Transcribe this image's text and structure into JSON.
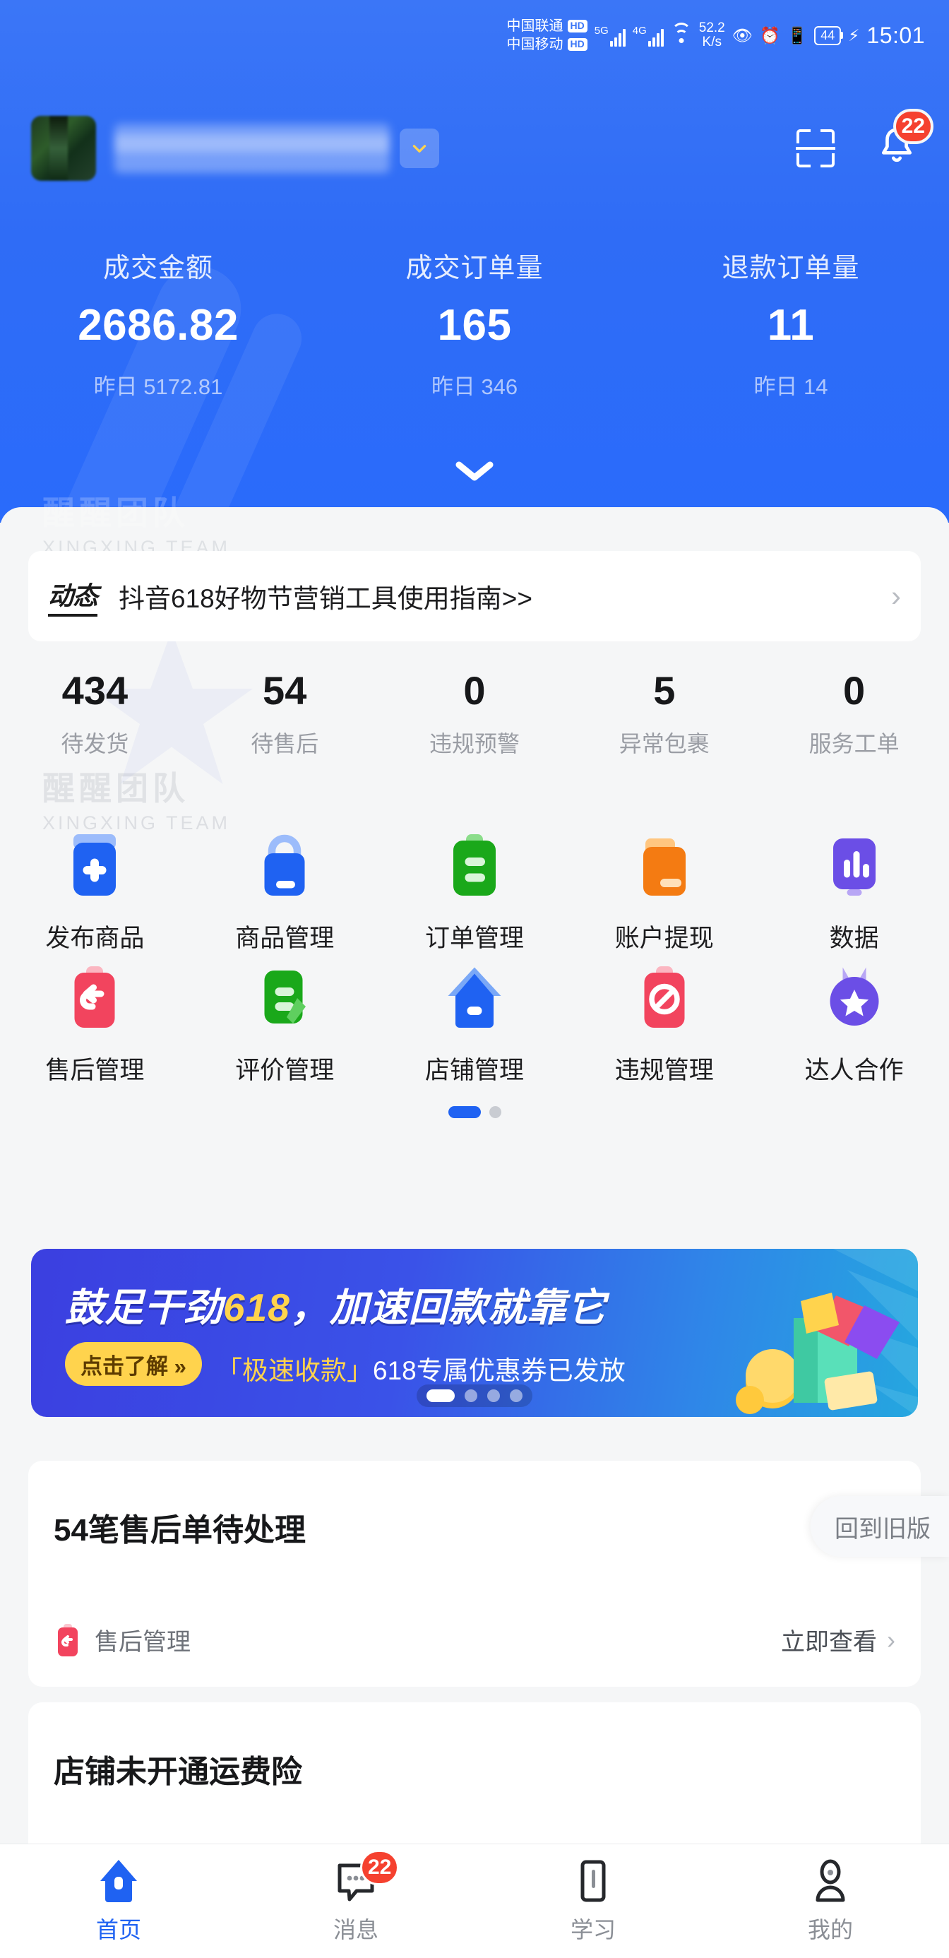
{
  "status_bar": {
    "carrier_1": "中国联通",
    "carrier_2": "中国移动",
    "hd_label": "HD",
    "net_1": "5G",
    "net_2": "4G",
    "speed": "52.2",
    "speed_unit": "K/s",
    "battery": "44",
    "time": "15:01"
  },
  "header": {
    "shop_name": "",
    "notification_badge": "22"
  },
  "hero_stats": [
    {
      "label": "成交金额",
      "value": "2686.82",
      "sub": "昨日 5172.81"
    },
    {
      "label": "成交订单量",
      "value": "165",
      "sub": "昨日 346"
    },
    {
      "label": "退款订单量",
      "value": "11",
      "sub": "昨日 14"
    }
  ],
  "watermark": {
    "cn": "醒醒团队",
    "en": "XINGXING TEAM"
  },
  "notice": {
    "tag": "动态",
    "text": "抖音618好物节营销工具使用指南>>"
  },
  "counters": [
    {
      "num": "434",
      "name": "待发货"
    },
    {
      "num": "54",
      "name": "待售后"
    },
    {
      "num": "0",
      "name": "违规预警"
    },
    {
      "num": "5",
      "name": "异常包裹"
    },
    {
      "num": "0",
      "name": "服务工单"
    }
  ],
  "grid": {
    "row1": [
      {
        "label": "发布商品",
        "icon": "plus-tag-icon",
        "color": "#1f62f2"
      },
      {
        "label": "商品管理",
        "icon": "shopping-bag-icon",
        "color": "#1f62f2"
      },
      {
        "label": "订单管理",
        "icon": "clipboard-icon",
        "color": "#1aa81a"
      },
      {
        "label": "账户提现",
        "icon": "folder-icon",
        "color": "#f47b12"
      },
      {
        "label": "数据",
        "icon": "bar-chart-icon",
        "color": "#6b4ee6"
      }
    ],
    "row2": [
      {
        "label": "售后管理",
        "icon": "return-tag-icon",
        "color": "#f2445e"
      },
      {
        "label": "评价管理",
        "icon": "review-pen-icon",
        "color": "#1aa81a"
      },
      {
        "label": "店铺管理",
        "icon": "home-icon",
        "color": "#1f62f2"
      },
      {
        "label": "违规管理",
        "icon": "ban-tag-icon",
        "color": "#f2445e"
      },
      {
        "label": "达人合作",
        "icon": "star-medal-icon",
        "color": "#6b4ee6"
      }
    ],
    "page_dots": 2,
    "page_active": 0
  },
  "promo": {
    "title_a": "鼓足干劲",
    "title_b": "618",
    "title_c": "，加速回款就靠它",
    "button": "点击了解 »",
    "sub_a": "「极速收款」",
    "sub_b": "618",
    "sub_c": "专属优惠券已发放",
    "dots": 4,
    "dot_active": 0
  },
  "cards": [
    {
      "title": "54笔售后单待处理",
      "icon": "return-tag-icon",
      "link_name": "售后管理",
      "action": "立即查看"
    },
    {
      "title": "店铺未开通运费险",
      "icon": "",
      "link_name": "",
      "action": ""
    }
  ],
  "old_version_button": "回到旧版",
  "tabbar": [
    {
      "label": "首页",
      "icon": "home-icon",
      "active": true,
      "badge": ""
    },
    {
      "label": "消息",
      "icon": "message-icon",
      "active": false,
      "badge": "22"
    },
    {
      "label": "学习",
      "icon": "book-icon",
      "active": false,
      "badge": ""
    },
    {
      "label": "我的",
      "icon": "person-icon",
      "active": false,
      "badge": ""
    }
  ],
  "colors": {
    "brand_blue": "#1f62f2",
    "hero_blue": "#2f6cf6",
    "badge_red": "#f5412f",
    "accent_yellow": "#ffd34d",
    "bg_gray": "#f5f6f7"
  }
}
